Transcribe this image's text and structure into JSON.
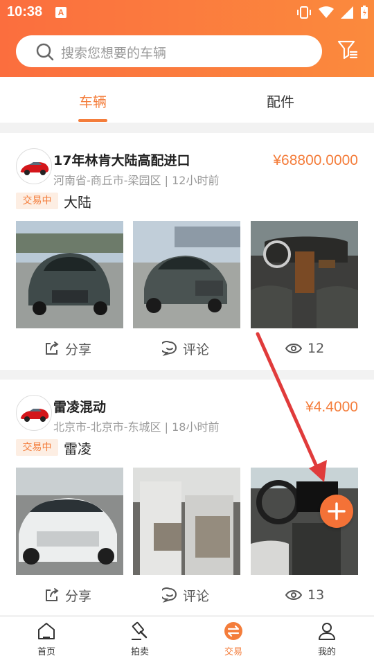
{
  "status": {
    "time": "10:38",
    "notif": "A"
  },
  "search": {
    "placeholder": "搜索您想要的车辆"
  },
  "tabs": [
    {
      "label": "车辆",
      "active": true
    },
    {
      "label": "配件",
      "active": false
    }
  ],
  "listings": [
    {
      "title": "17年林肯大陆高配进口",
      "location": "河南省-商丘市-梁园区 | 12小时前",
      "price": "¥68800.0000",
      "status": "交易中",
      "brand": "大陆",
      "actions": {
        "share": "分享",
        "comment": "评论",
        "views": "12"
      }
    },
    {
      "title": "雷凌混动",
      "location": "北京市-北京市-东城区 | 18小时前",
      "price": "¥4.4000",
      "status": "交易中",
      "brand": "雷凌",
      "actions": {
        "share": "分享",
        "comment": "评论",
        "views": "13"
      }
    }
  ],
  "bottom_nav": [
    {
      "label": "首页",
      "icon": "home-icon"
    },
    {
      "label": "拍卖",
      "icon": "gavel-icon"
    },
    {
      "label": "交易",
      "icon": "trade-icon",
      "active": true
    },
    {
      "label": "我的",
      "icon": "user-icon"
    }
  ],
  "colors": {
    "accent": "#f47d3b",
    "header_start": "#fb6e3e",
    "header_end": "#fb8a3d",
    "arrow": "#e03b3b"
  }
}
